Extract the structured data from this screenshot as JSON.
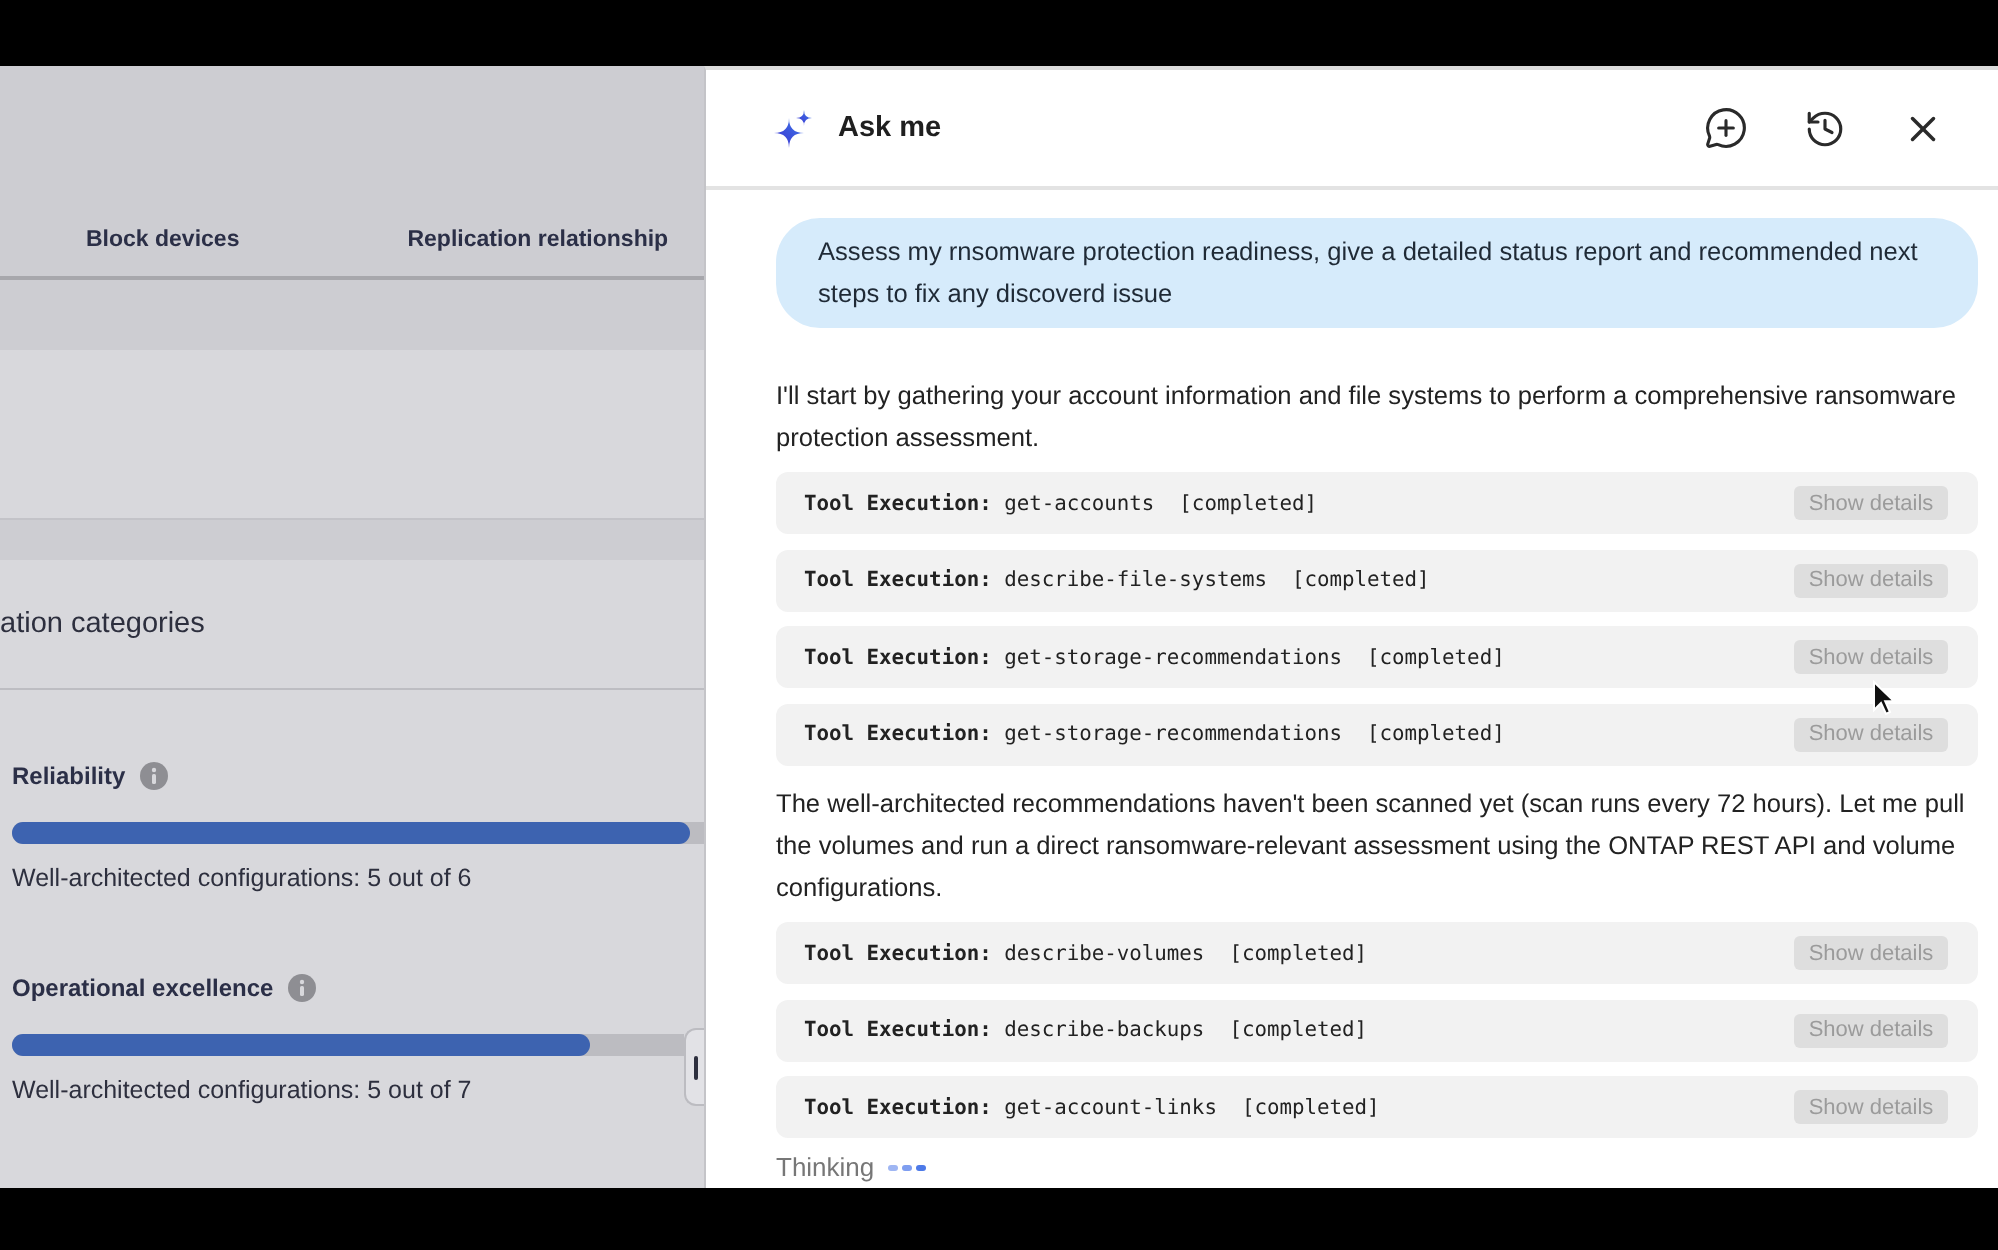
{
  "left_panel": {
    "tabs": [
      {
        "label": "Block devices",
        "selected": false
      },
      {
        "label": "Replication relationship",
        "selected": false
      }
    ],
    "section_title": "ation categories",
    "categories": [
      {
        "name": "Reliability",
        "level": 0.98,
        "summary": "Well-architected configurations: 5 out of 6"
      },
      {
        "name": "Operational excellence",
        "level": 0.86,
        "summary": "Well-architected configurations: 5 out of 7"
      }
    ]
  },
  "chat_panel": {
    "title": "Ask me",
    "messages": [
      {
        "kind": "user",
        "text": "Assess my rnsomware protection readiness, give a detailed status report and recommended next steps to fix any discoverd issue"
      },
      {
        "kind": "assistant",
        "text": "I'll start by gathering your account information and file systems to perform a comprehensive ransomware protection assessment."
      },
      {
        "kind": "tool",
        "text": "**Tool Execution:** get-accounts  [completed]",
        "action": "Show details"
      },
      {
        "kind": "tool",
        "text": "**Tool Execution:** describe-file-systems  [completed]",
        "action": "Show details"
      },
      {
        "kind": "tool",
        "text": "**Tool Execution:** get-storage-recommendations  [completed]",
        "action": "Show details"
      },
      {
        "kind": "tool",
        "text": "**Tool Execution:** get-storage-recommendations  [completed]",
        "action": "Show details"
      },
      {
        "kind": "assistant",
        "text": "The well-architected recommendations haven't been scanned yet (scan runs every 72 hours). Let me pull the volumes and run a direct ransomware-relevant assessment using the ONTAP REST API and volume configurations."
      },
      {
        "kind": "tool",
        "text": "**Tool Execution:** describe-volumes  [completed]",
        "action": "Show details"
      },
      {
        "kind": "tool",
        "text": "**Tool Execution:** describe-backups  [completed]",
        "action": "Show details"
      },
      {
        "kind": "tool",
        "text": "**Tool Execution:** get-account-links  [completed]",
        "action": "Show details"
      }
    ],
    "thinking": "Thinking"
  }
}
